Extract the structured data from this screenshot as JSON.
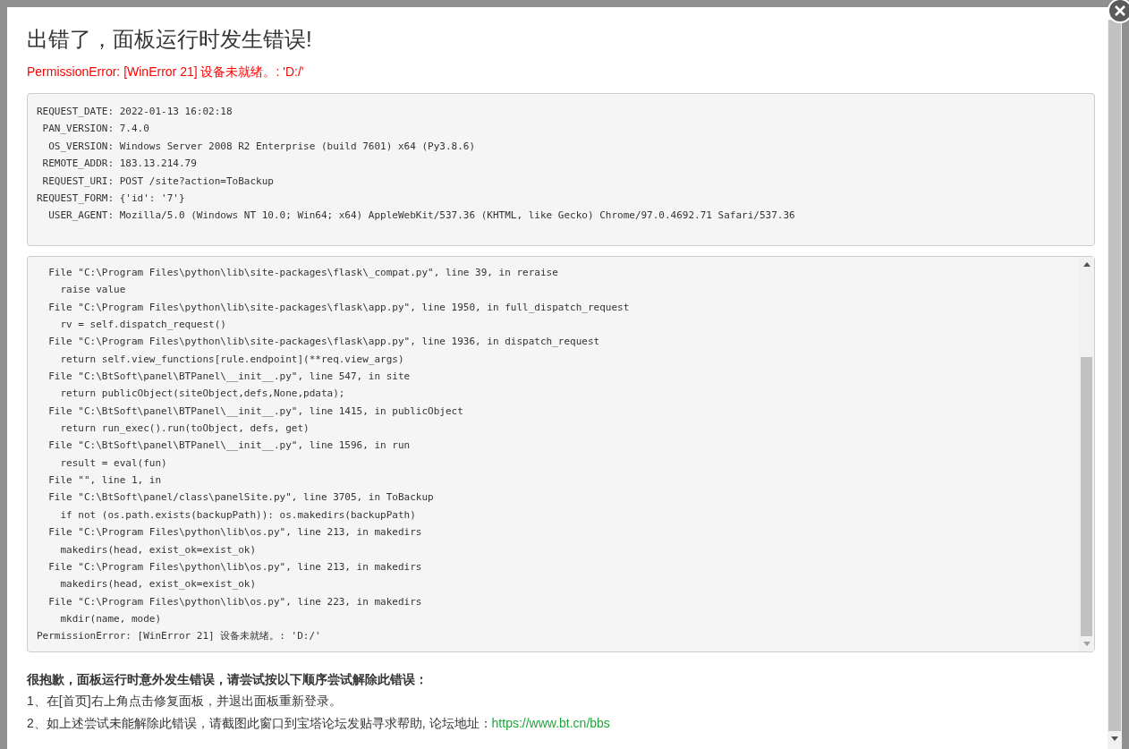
{
  "dialog": {
    "title": "出错了，面板运行时发生错误!",
    "error_message": "PermissionError: [WinError 21] 设备未就绪。: 'D:/'",
    "request_info": [
      "REQUEST_DATE: 2022-01-13 16:02:18",
      " PAN_VERSION: 7.4.0",
      "  OS_VERSION: Windows Server 2008 R2 Enterprise (build 7601) x64 (Py3.8.6)",
      " REMOTE_ADDR: 183.13.214.79",
      " REQUEST_URI: POST /site?action=ToBackup",
      "REQUEST_FORM: {'id': '7'}",
      "  USER_AGENT: Mozilla/5.0 (Windows NT 10.0; Win64; x64) AppleWebKit/537.36 (KHTML, like Gecko) Chrome/97.0.4692.71 Safari/537.36"
    ],
    "traceback": [
      "  File \"C:\\Program Files\\python\\lib\\site-packages\\flask\\_compat.py\", line 39, in reraise",
      "    raise value",
      "  File \"C:\\Program Files\\python\\lib\\site-packages\\flask\\app.py\", line 1950, in full_dispatch_request",
      "    rv = self.dispatch_request()",
      "  File \"C:\\Program Files\\python\\lib\\site-packages\\flask\\app.py\", line 1936, in dispatch_request",
      "    return self.view_functions[rule.endpoint](**req.view_args)",
      "  File \"C:\\BtSoft\\panel\\BTPanel\\__init__.py\", line 547, in site",
      "    return publicObject(siteObject,defs,None,pdata);",
      "  File \"C:\\BtSoft\\panel\\BTPanel\\__init__.py\", line 1415, in publicObject",
      "    return run_exec().run(toObject, defs, get)",
      "  File \"C:\\BtSoft\\panel\\BTPanel\\__init__.py\", line 1596, in run",
      "    result = eval(fun)",
      "  File \"\", line 1, in",
      "  File \"C:\\BtSoft\\panel/class\\panelSite.py\", line 3705, in ToBackup",
      "    if not (os.path.exists(backupPath)): os.makedirs(backupPath)",
      "  File \"C:\\Program Files\\python\\lib\\os.py\", line 213, in makedirs",
      "    makedirs(head, exist_ok=exist_ok)",
      "  File \"C:\\Program Files\\python\\lib\\os.py\", line 213, in makedirs",
      "    makedirs(head, exist_ok=exist_ok)",
      "  File \"C:\\Program Files\\python\\lib\\os.py\", line 223, in makedirs",
      "    mkdir(name, mode)",
      "PermissionError: [WinError 21] 设备未就绪。: 'D:/'"
    ],
    "help_heading": "很抱歉，面板运行时意外发生错误，请尝试按以下顺序尝试解除此错误：",
    "help_steps": [
      {
        "text": "1、在[首页]右上角点击修复面板，并退出面板重新登录。"
      },
      {
        "text": "2、如上述尝试未能解除此错误，请截图此窗口到宝塔论坛发贴寻求帮助, 论坛地址：",
        "link": "https://www.bt.cn/bbs"
      }
    ]
  }
}
